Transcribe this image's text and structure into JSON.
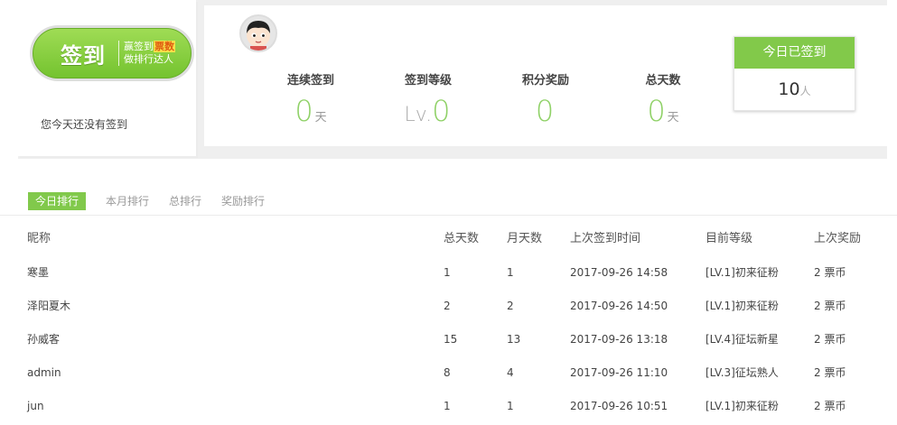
{
  "sign": {
    "button_main": "签到",
    "sub_line1": "赢签到",
    "sub_highlight": "票数",
    "sub_line2": "做排行达人",
    "status_text": "您今天还没有签到"
  },
  "stats": [
    {
      "label": "连续签到",
      "prefix": "",
      "value": "0",
      "unit": "天"
    },
    {
      "label": "签到等级",
      "prefix": "Lv.",
      "value": "0",
      "unit": ""
    },
    {
      "label": "积分奖励",
      "prefix": "",
      "value": "0",
      "unit": ""
    },
    {
      "label": "总天数",
      "prefix": "",
      "value": "0",
      "unit": "天"
    }
  ],
  "today": {
    "title": "今日已签到",
    "count": "10",
    "unit": "人"
  },
  "tabs": [
    "今日排行",
    "本月排行",
    "总排行",
    "奖励排行"
  ],
  "table": {
    "headers": [
      "昵称",
      "总天数",
      "月天数",
      "上次签到时间",
      "目前等级",
      "上次奖励"
    ],
    "rows": [
      [
        "寒墨",
        "1",
        "1",
        "2017-09-26 14:58",
        "[LV.1]初来征粉",
        "2 票币"
      ],
      [
        "泽阳夏木",
        "2",
        "2",
        "2017-09-26 14:50",
        "[LV.1]初来征粉",
        "2 票币"
      ],
      [
        "孙威客",
        "15",
        "13",
        "2017-09-26 13:18",
        "[LV.4]征坛新星",
        "2 票币"
      ],
      [
        "admin",
        "8",
        "4",
        "2017-09-26 11:10",
        "[LV.3]征坛熟人",
        "2 票币"
      ],
      [
        "jun",
        "1",
        "1",
        "2017-09-26 10:51",
        "[LV.1]初来征粉",
        "2 票币"
      ]
    ]
  },
  "colors": {
    "accent_green": "#81c94b",
    "stat_green": "#8fd167"
  },
  "icons": {
    "avatar": "cartoon-avatar-icon"
  }
}
